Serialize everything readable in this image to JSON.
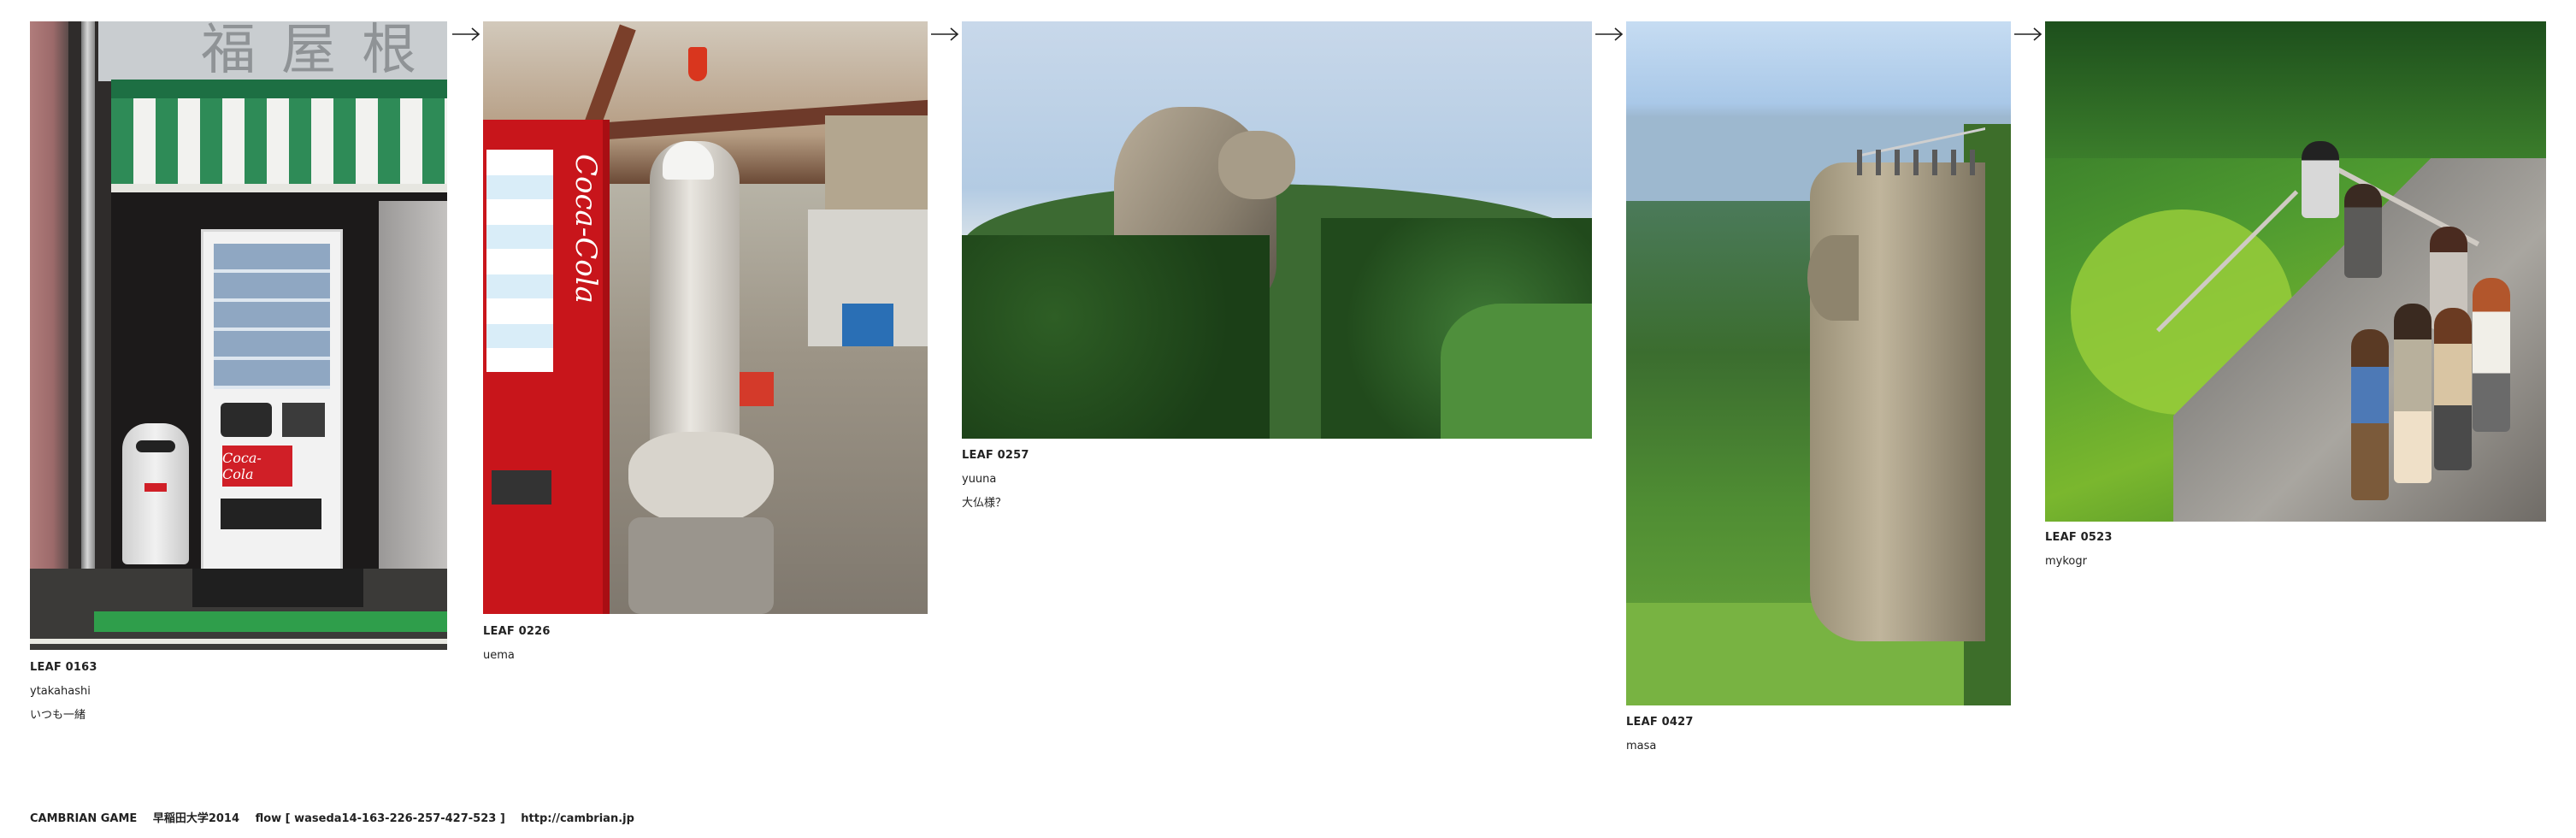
{
  "leaves": [
    {
      "id": "LEAF 0163",
      "user": "ytakahashi",
      "comment": "いつも一緒"
    },
    {
      "id": "LEAF 0226",
      "user": "uema",
      "comment": ""
    },
    {
      "id": "LEAF 0257",
      "user": "yuuna",
      "comment": "大仏様？"
    },
    {
      "id": "LEAF 0427",
      "user": "masa",
      "comment": ""
    },
    {
      "id": "LEAF 0523",
      "user": "mykogr",
      "comment": ""
    }
  ],
  "photos": {
    "leaf1": {
      "sign_text": "福屋根",
      "brand": "Coca-Cola"
    },
    "leaf2": {
      "brand": "Coca-Cola"
    }
  },
  "footer": {
    "game": "CAMBRIAN GAME",
    "school": "早稲田大学2014",
    "flow": "flow [ waseda14-163-226-257-427-523 ]",
    "url": "http://cambrian.jp"
  },
  "arrow_icon": "right-arrow-icon"
}
